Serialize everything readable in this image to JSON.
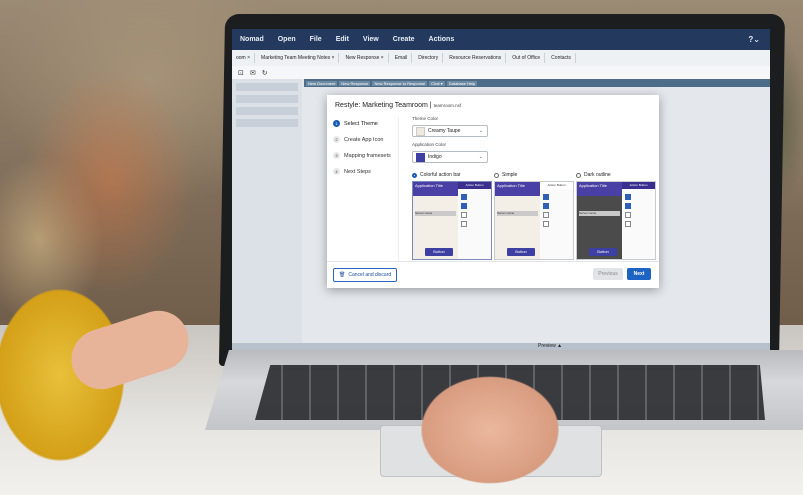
{
  "app": {
    "menu": [
      "Nomad",
      "Open",
      "File",
      "Edit",
      "View",
      "Create",
      "Actions"
    ],
    "help_icon": "question-circle-icon"
  },
  "tabs": [
    "oom ×",
    "Marketing Team Meeting Notes ×",
    "New Response ×",
    "Email",
    "Directory",
    "Resource Reservations",
    "Out of Office",
    "Contacts"
  ],
  "action_bar": [
    "New Document",
    "New Response",
    "New Response to Response",
    "Chat ▾",
    "Database Help"
  ],
  "status_text": "Preview ▲",
  "dialog": {
    "title": "Restyle:  Marketing Teamroom",
    "subtitle": "teamroom.nsf",
    "steps": [
      {
        "num": "1",
        "label": "Select Theme"
      },
      {
        "num": "2",
        "label": "Create App Icon"
      },
      {
        "num": "3",
        "label": "Mapping framesets"
      },
      {
        "num": "4",
        "label": "Next Steps"
      }
    ],
    "theme_color_label": "Theme Color",
    "theme_color_value": "Creamy Taupe",
    "app_color_label": "Application Color",
    "app_color_value": "Indigo",
    "options": [
      "Colorful action bar",
      "Simple",
      "Dark outline"
    ],
    "preview_title": "Application Title",
    "preview_action": "Action Button",
    "preview_server": "Server name",
    "preview_button": "Button",
    "cancel_label": "Cancel and discard",
    "previous_label": "Previous",
    "next_label": "Next"
  },
  "colors": {
    "menubar": "#23395d",
    "accent_blue": "#1d63c4",
    "indigo": "#3d3fa3",
    "creamy_taupe": "#efe9df"
  }
}
